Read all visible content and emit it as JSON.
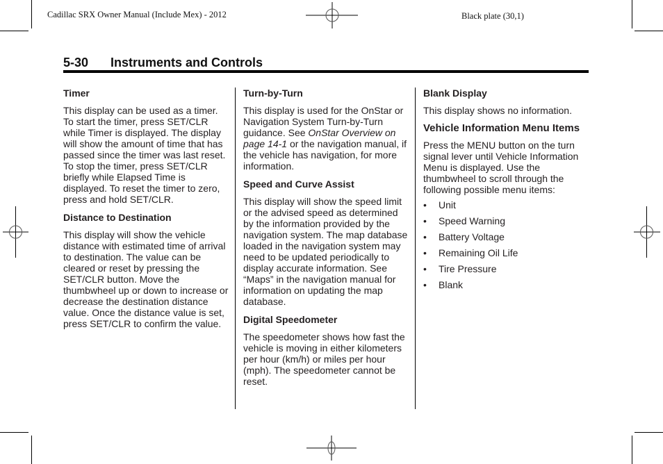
{
  "header": {
    "left_text": "Cadillac SRX Owner Manual (Include Mex) - 2012",
    "right_text": "Black plate (30,1)"
  },
  "section": {
    "number": "5-30",
    "title": "Instruments and Controls"
  },
  "column1": {
    "timer": {
      "heading": "Timer",
      "body": "This display can be used as a timer. To start the timer, press SET/CLR while Timer is displayed. The display will show the amount of time that has passed since the timer was last reset. To stop the timer, press SET/CLR briefly while Elapsed Time is displayed. To reset the timer to zero, press and hold SET/CLR."
    },
    "distance": {
      "heading": "Distance to Destination",
      "body": "This display will show the vehicle distance with estimated time of arrival to destination. The value can be cleared or reset by pressing the SET/CLR button. Move the thumbwheel up or down to increase or decrease the destination distance value. Once the distance value is set, press SET/CLR to confirm the value."
    }
  },
  "column2": {
    "turn_by_turn": {
      "heading": "Turn-by-Turn",
      "body_before": "This display is used for the OnStar or Navigation System Turn-by-Turn guidance. See ",
      "link": "OnStar Overview on page 14-1",
      "body_after": " or the navigation manual, if the vehicle has navigation, for more information."
    },
    "speed_curve": {
      "heading": "Speed and Curve Assist",
      "body": "This display will show the speed limit or the advised speed as determined by the information provided by the navigation system. The map database loaded in the navigation system may need to be updated periodically to display accurate information. See “Maps” in the navigation manual for information on updating the map database."
    },
    "digital_speedometer": {
      "heading": "Digital Speedometer",
      "body": "The speedometer shows how fast the vehicle is moving in either kilometers per hour (km/h) or miles per hour (mph). The speedometer cannot be reset."
    }
  },
  "column3": {
    "blank_display": {
      "heading": "Blank Display",
      "body": "This display shows no information."
    },
    "vehicle_info_menu": {
      "heading": "Vehicle Information Menu Items",
      "body": "Press the MENU button on the turn signal lever until Vehicle Information Menu is displayed. Use the thumbwheel to scroll through the following possible menu items:",
      "bullet_glyph": "•",
      "items": [
        "Unit",
        "Speed Warning",
        "Battery Voltage",
        "Remaining Oil Life",
        "Tire Pressure",
        "Blank"
      ]
    }
  }
}
